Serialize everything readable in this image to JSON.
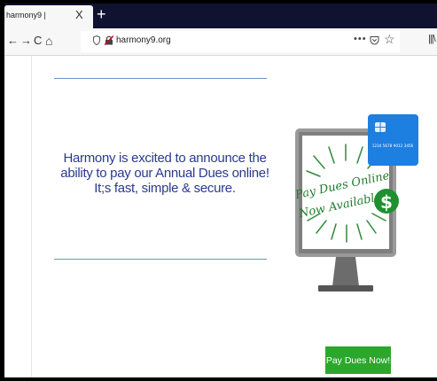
{
  "browser": {
    "tab_title": "harmony9 |",
    "tab_close": "X",
    "new_tab": "+",
    "nav_back": "←",
    "nav_forward": "→",
    "nav_reload": "C",
    "nav_home": "⌂",
    "url": "harmony9.org",
    "url_menu": "•••",
    "url_star": "☆",
    "library": "|||\\"
  },
  "page": {
    "headline": "Harmony is excited to announce the ability to pay our Annual Dues online! It;s fast, simple & secure.",
    "promo_line1": "Pay Dues Online",
    "promo_line2": "Now Available!",
    "dollar_symbol": "$",
    "card_number": "1234 5678 9012 3456",
    "pay_button": "Pay Dues Now!"
  },
  "colors": {
    "tabbar": "#0f1330",
    "headline": "#2a3a8e",
    "rule": "#6d93c7",
    "button": "#2ba82b",
    "promo_green": "#1f7d2d",
    "card_blue": "#1d7fe0"
  }
}
